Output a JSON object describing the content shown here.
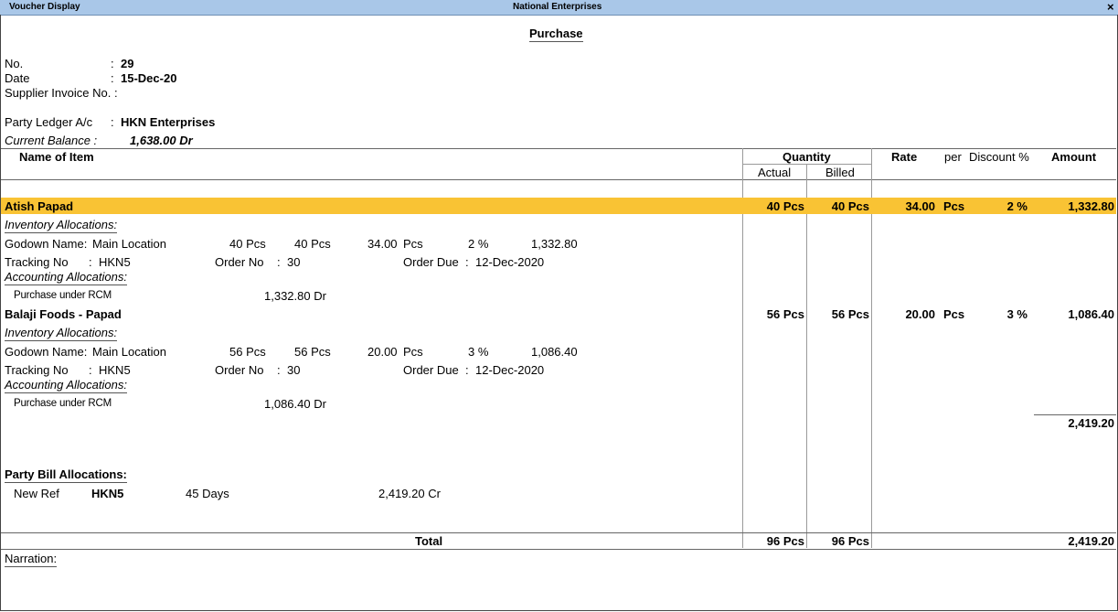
{
  "titlebar": {
    "left": "Voucher Display",
    "center": "National Enterprises",
    "close": "×"
  },
  "voucher": {
    "type": "Purchase",
    "no_label": "No.",
    "no_colon": ":",
    "no": "29",
    "date_label": "Date",
    "date_colon": ":",
    "date": "15-Dec-20",
    "supplier_inv_label": "Supplier Invoice No. :",
    "party_label": "Party Ledger A/c",
    "party_colon": ":",
    "party": "HKN Enterprises",
    "balance_label": "Current Balance :",
    "balance": "1,638.00 Dr"
  },
  "columns": {
    "name": "Name of Item",
    "quantity": "Quantity",
    "actual": "Actual",
    "billed": "Billed",
    "rate": "Rate",
    "per": "per",
    "discount": "Discount %",
    "amount": "Amount"
  },
  "items": [
    {
      "name": "Atish Papad",
      "actual": "40 Pcs",
      "billed": "40 Pcs",
      "rate": "34.00",
      "per": "Pcs",
      "discount": "2 %",
      "amount": "1,332.80",
      "inv_label": "Inventory Allocations:",
      "godown_label": "Godown Name:",
      "godown": "Main Location",
      "g_actual": "40 Pcs",
      "g_billed": "40 Pcs",
      "g_rate": "34.00",
      "g_per": "Pcs",
      "g_disc": "2 %",
      "g_amount": "1,332.80",
      "tracking_label": "Tracking No",
      "tracking_colon": ":",
      "tracking": "HKN5",
      "order_label": "Order No",
      "order_colon": ":",
      "order": "30",
      "due_label": "Order Due",
      "due_colon": ":",
      "due": "12-Dec-2020",
      "acc_label": "Accounting Allocations:",
      "ledger": "Purchase under RCM",
      "ledger_amount": "1,332.80 Dr"
    },
    {
      "name": "Balaji Foods - Papad",
      "actual": "56 Pcs",
      "billed": "56 Pcs",
      "rate": "20.00",
      "per": "Pcs",
      "discount": "3 %",
      "amount": "1,086.40",
      "inv_label": "Inventory Allocations:",
      "godown_label": "Godown Name:",
      "godown": "Main Location",
      "g_actual": "56 Pcs",
      "g_billed": "56 Pcs",
      "g_rate": "20.00",
      "g_per": "Pcs",
      "g_disc": "3 %",
      "g_amount": "1,086.40",
      "tracking_label": "Tracking No",
      "tracking_colon": ":",
      "tracking": "HKN5",
      "order_label": "Order No",
      "order_colon": ":",
      "order": "30",
      "due_label": "Order Due",
      "due_colon": ":",
      "due": "12-Dec-2020",
      "acc_label": "Accounting Allocations:",
      "ledger": "Purchase under RCM",
      "ledger_amount": "1,086.40 Dr"
    }
  ],
  "subtotal": "2,419.20",
  "bill": {
    "label": "Party Bill Allocations:",
    "type": "New Ref",
    "ref": "HKN5",
    "days": "45 Days",
    "amount": "2,419.20 Cr"
  },
  "total": {
    "label": "Total",
    "actual": "96 Pcs",
    "billed": "96 Pcs",
    "amount": "2,419.20"
  },
  "narration_label": "Narration:"
}
